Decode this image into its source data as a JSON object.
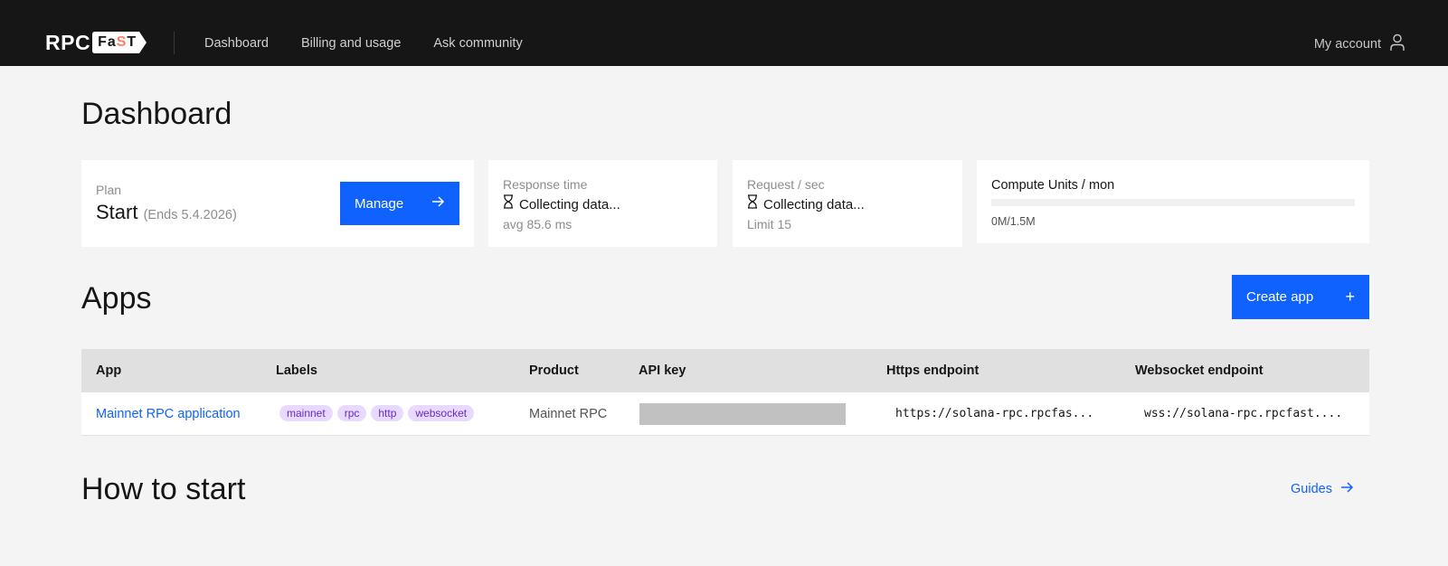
{
  "header": {
    "logo_rpc": "RPC",
    "logo_fast_a": "Fa",
    "logo_fast_s": "S",
    "logo_fast_t": "T",
    "nav": [
      "Dashboard",
      "Billing and usage",
      "Ask community"
    ],
    "account_label": "My account"
  },
  "page": {
    "title": "Dashboard"
  },
  "stats": {
    "plan": {
      "label": "Plan",
      "name": "Start",
      "ends": "(Ends 5.4.2026)",
      "button_label": "Manage"
    },
    "response_time": {
      "label": "Response time",
      "value": "Collecting data...",
      "sub": "avg 85.6 ms"
    },
    "requests": {
      "label": "Request / sec",
      "value": "Collecting data...",
      "sub": "Limit 15"
    },
    "compute_units": {
      "label": "Compute Units / mon",
      "value": "0M/1.5M",
      "progress_percent": 0
    }
  },
  "apps": {
    "title": "Apps",
    "create_label": "Create app",
    "create_symbol": "+",
    "columns": [
      "App",
      "Labels",
      "Product",
      "API key",
      "Https endpoint",
      "Websocket endpoint"
    ],
    "rows": [
      {
        "app": "Mainnet RPC application",
        "labels": [
          "mainnet",
          "rpc",
          "http",
          "websocket"
        ],
        "product": "Mainnet RPC",
        "https": "https://solana-rpc.rpcfas...",
        "wss": "wss://solana-rpc.rpcfast...."
      }
    ]
  },
  "how_to_start": {
    "title": "How to start",
    "link_label": "Guides"
  },
  "colors": {
    "primary": "#0f62fe",
    "header_bg": "#161616",
    "tag_bg": "#e8daff",
    "tag_text": "#6929c4"
  }
}
